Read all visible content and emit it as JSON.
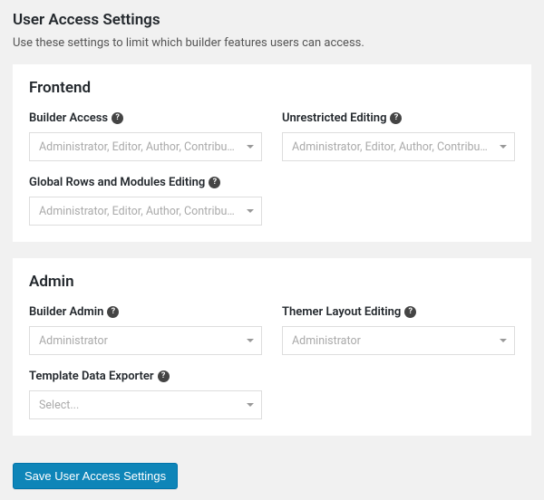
{
  "page": {
    "title": "User Access Settings",
    "description": "Use these settings to limit which builder features users can access."
  },
  "panels": {
    "frontend": {
      "title": "Frontend",
      "builder_access": {
        "label": "Builder Access",
        "value": "Administrator, Editor, Author, Contributor"
      },
      "unrestricted_editing": {
        "label": "Unrestricted Editing",
        "value": "Administrator, Editor, Author, Contributor"
      },
      "global_rows": {
        "label": "Global Rows and Modules Editing",
        "value": "Administrator, Editor, Author, Contributor"
      }
    },
    "admin": {
      "title": "Admin",
      "builder_admin": {
        "label": "Builder Admin",
        "value": "Administrator"
      },
      "themer_layout": {
        "label": "Themer Layout Editing",
        "value": "Administrator"
      },
      "template_exporter": {
        "label": "Template Data Exporter",
        "value": "Select..."
      }
    }
  },
  "save_button": "Save User Access Settings",
  "help_glyph": "?"
}
